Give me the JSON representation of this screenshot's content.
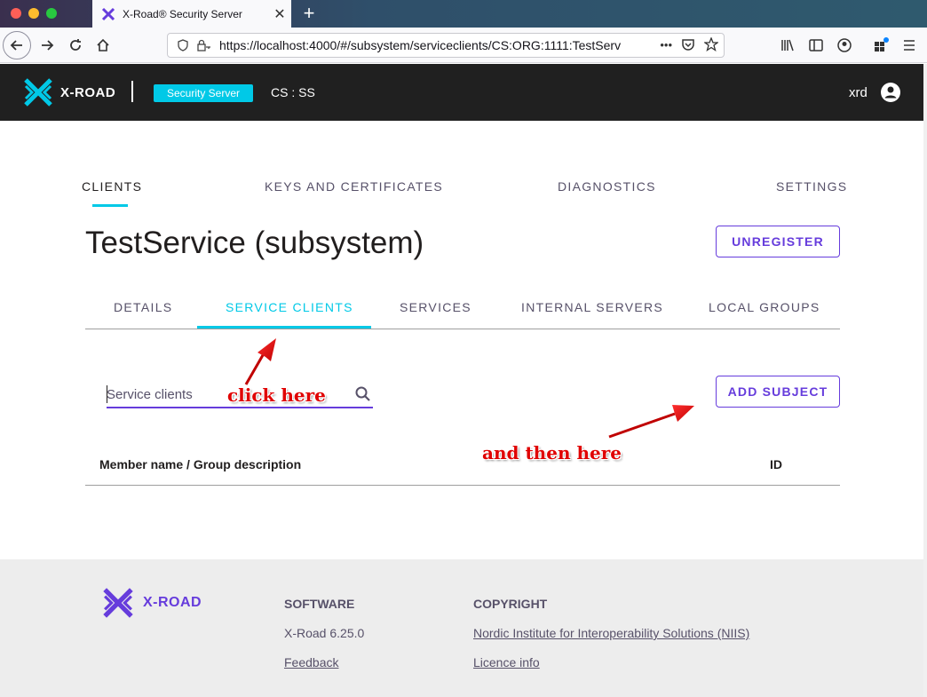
{
  "browser": {
    "tab_title": "X-Road® Security Server",
    "url": "https://localhost:4000/#/subsystem/serviceclients/CS:ORG:1111:TestServ",
    "url_more": "•••"
  },
  "header": {
    "logo_text": "X-ROAD",
    "badge": "Security Server",
    "instance": "CS : SS",
    "user": "xrd"
  },
  "main_nav": {
    "clients": "CLIENTS",
    "keys": "KEYS AND CERTIFICATES",
    "diagnostics": "DIAGNOSTICS",
    "settings": "SETTINGS"
  },
  "page": {
    "title": "TestService (subsystem)",
    "unregister_label": "UNREGISTER"
  },
  "sub_tabs": {
    "details": "DETAILS",
    "service_clients": "SERVICE CLIENTS",
    "services": "SERVICES",
    "internal_servers": "INTERNAL SERVERS",
    "local_groups": "LOCAL GROUPS"
  },
  "search": {
    "placeholder": "Service clients"
  },
  "add_subject_label": "ADD SUBJECT",
  "table": {
    "col_member": "Member name / Group description",
    "col_id": "ID"
  },
  "annotations": {
    "click_here": "click here",
    "then_here": "and then here"
  },
  "footer": {
    "logo_text": "X-ROAD",
    "software_heading": "SOFTWARE",
    "version": "X-Road 6.25.0",
    "feedback": "Feedback",
    "copyright_heading": "COPYRIGHT",
    "niis": "Nordic Institute for Interoperability Solutions (NIIS)",
    "licence": "Licence info"
  },
  "colors": {
    "accent_cyan": "#00c9e7",
    "accent_purple": "#663cdc",
    "header_bg": "#202020"
  }
}
